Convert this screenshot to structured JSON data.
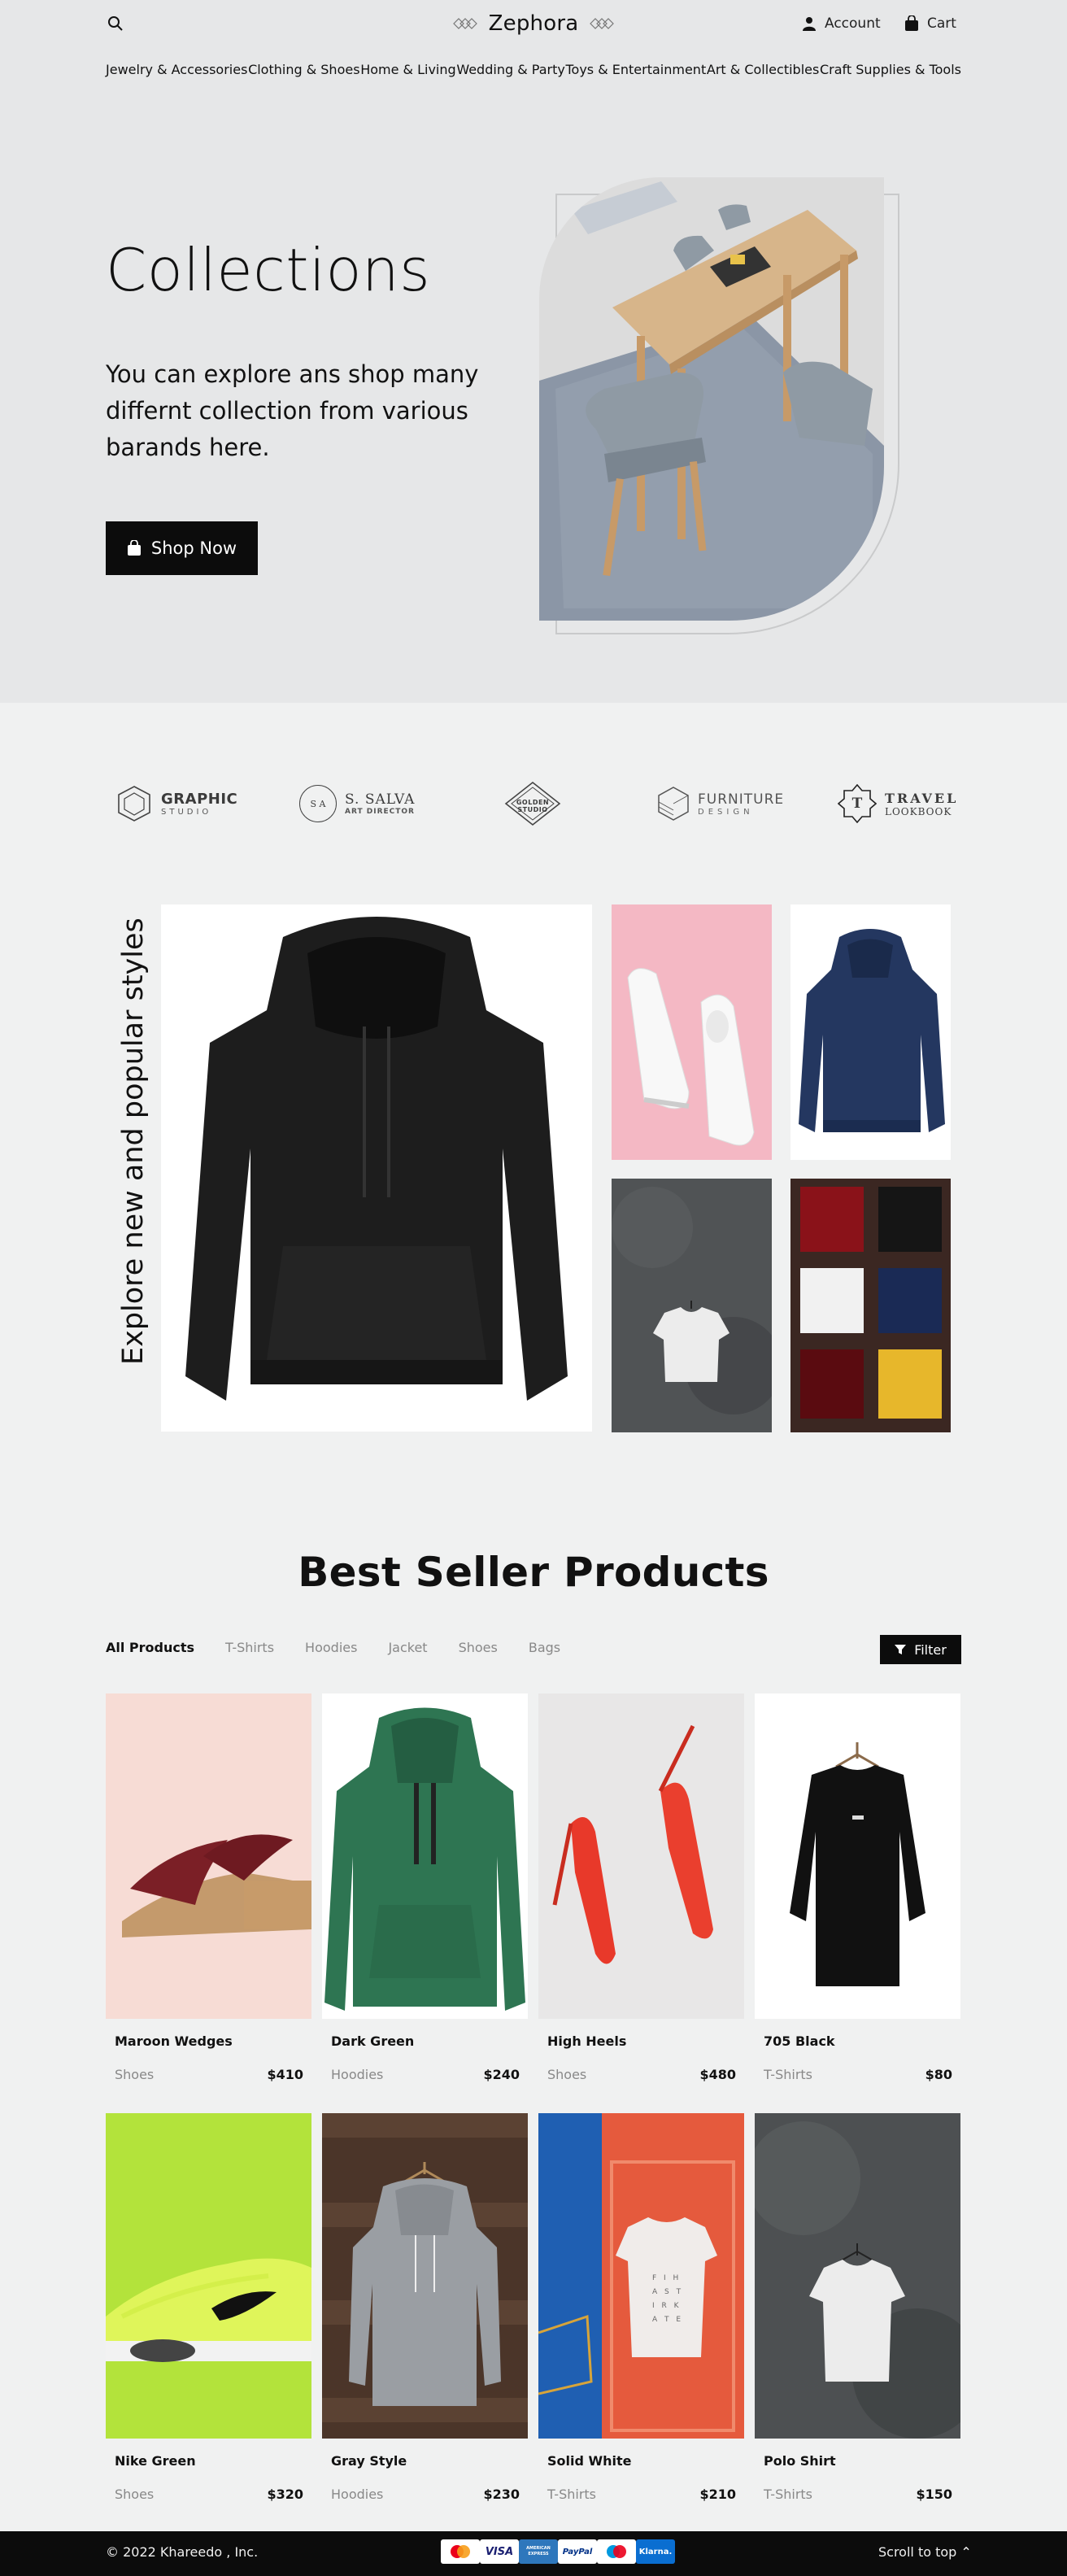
{
  "header": {
    "brand": "Zephora",
    "account_label": "Account",
    "cart_label": "Cart"
  },
  "nav": {
    "items": [
      "Jewelry & Accessories",
      "Clothing & Shoes",
      "Home & Living",
      "Wedding & Party",
      "Toys & Entertainment",
      "Art & Collectibles",
      "Craft Supplies & Tools"
    ]
  },
  "hero": {
    "title": "Collections",
    "subtitle": "You can explore ans shop many differnt collection from various barands here.",
    "button_label": "Shop Now"
  },
  "brands": [
    {
      "name": "GRAPHIC",
      "sub": "STUDIO"
    },
    {
      "name": "S. SALVA",
      "sub": "ART DIRECTOR",
      "mark": "S A"
    },
    {
      "name": "GOLDEN STUDIO"
    },
    {
      "name": "FURNITURE",
      "sub": "DESIGN"
    },
    {
      "name": "TRAVEL",
      "sub": "LOOKBOOK",
      "mark": "T"
    }
  ],
  "explore": {
    "title": "Explore new and popular styles"
  },
  "best_seller": {
    "title": "Best Seller Products",
    "tabs": [
      "All Products",
      "T-Shirts",
      "Hoodies",
      "Jacket",
      "Shoes",
      "Bags"
    ],
    "filter_label": "Filter",
    "products": [
      {
        "name": "Maroon Wedges",
        "category": "Shoes",
        "price": "$410"
      },
      {
        "name": "Dark Green",
        "category": "Hoodies",
        "price": "$240"
      },
      {
        "name": "High Heels",
        "category": "Shoes",
        "price": "$480"
      },
      {
        "name": "705 Black",
        "category": "T-Shirts",
        "price": "$80"
      },
      {
        "name": "Nike Green",
        "category": "Shoes",
        "price": "$320"
      },
      {
        "name": "Gray Style",
        "category": "Hoodies",
        "price": "$230"
      },
      {
        "name": "Solid White",
        "category": "T-Shirts",
        "price": "$210"
      },
      {
        "name": "Polo Shirt",
        "category": "T-Shirts",
        "price": "$150"
      }
    ]
  },
  "footer": {
    "copyright": "© 2022 Khareedo , Inc.",
    "payments": [
      "Mastercard",
      "VISA",
      "AMERICAN EXPRESS",
      "PayPal",
      "Maestro",
      "Klarna."
    ],
    "scroll_top_label": "Scroll to top ⌃"
  },
  "colors": {
    "hero_bg": "#e6e7e8",
    "page_bg": "#f0f1f1",
    "primary": "#0c0c0c"
  }
}
